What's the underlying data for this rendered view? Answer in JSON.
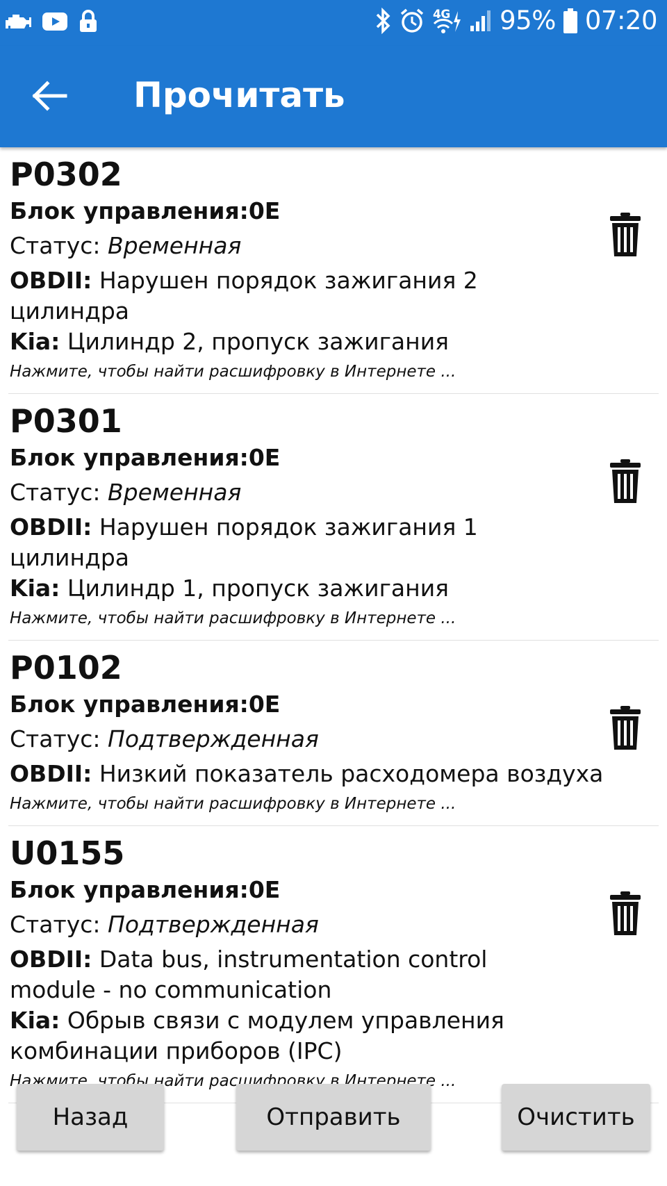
{
  "status_bar": {
    "battery_percent": "95%",
    "time": "07:20",
    "network": "4G",
    "icons": [
      "car-engine-icon",
      "youtube-icon",
      "lock-icon",
      "bluetooth-icon",
      "alarm-icon",
      "signal-4g-icon",
      "cell-signal-icon",
      "battery-icon"
    ]
  },
  "app_bar": {
    "title": "Прочитать",
    "back_icon": "arrow-back-icon"
  },
  "dtc_items": [
    {
      "code": "P0302",
      "block": "Блок управления:0E",
      "status_label": "Статус: ",
      "status_value": "Временная",
      "obd_label": "OBDII:",
      "obd_text": " Нарушен порядок зажигания 2 цилиндра",
      "maker_label": "Kia:",
      "maker_text": " Цилиндр 2, пропуск зажигания",
      "hint": "Нажмите, чтобы найти расшифровку в Интернете ..."
    },
    {
      "code": "P0301",
      "block": "Блок управления:0E",
      "status_label": "Статус: ",
      "status_value": "Временная",
      "obd_label": "OBDII:",
      "obd_text": " Нарушен порядок зажигания 1 цилиндра",
      "maker_label": "Kia:",
      "maker_text": " Цилиндр 1, пропуск зажигания",
      "hint": "Нажмите, чтобы найти расшифровку в Интернете ..."
    },
    {
      "code": "P0102",
      "block": "Блок управления:0E",
      "status_label": "Статус: ",
      "status_value": "Подтвержденная",
      "obd_label": "OBDII:",
      "obd_text": " Низкий показатель расходомера воздуха",
      "hint": "Нажмите, чтобы найти расшифровку в Интернете ..."
    },
    {
      "code": "U0155",
      "block": "Блок управления:0E",
      "status_label": "Статус: ",
      "status_value": "Подтвержденная",
      "obd_label": "OBDII:",
      "obd_text": " Data bus, instrumentation control module - no communication",
      "maker_label": "Kia:",
      "maker_text": " Обрыв связи с модулем управления комбинации приборов (IPC)",
      "hint": "Нажмите, чтобы найти расшифровку в Интернете ..."
    }
  ],
  "buttons": {
    "back": "Назад",
    "send": "Отправить",
    "clear": "Очистить"
  },
  "colors": {
    "primary": "#1e78d2",
    "button_bg": "#d6d6d6"
  }
}
